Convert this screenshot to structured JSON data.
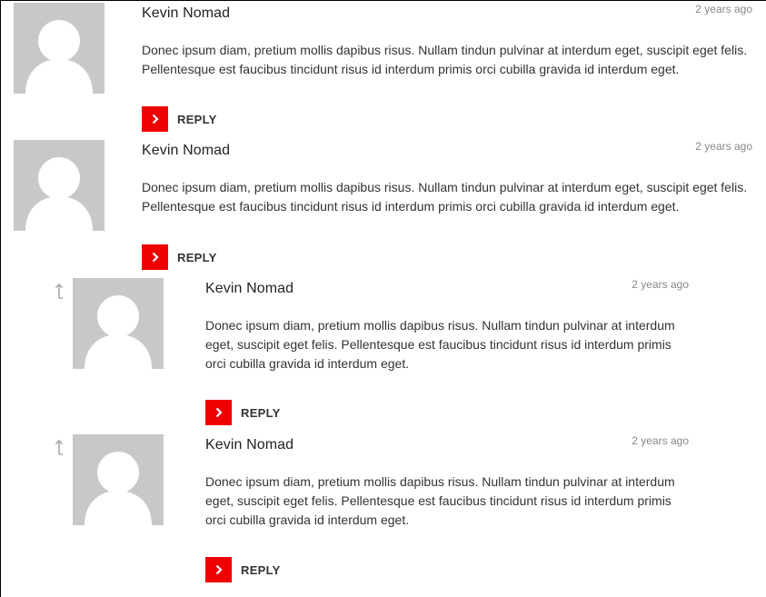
{
  "colors": {
    "accent": "#ee0000",
    "avatar_bg": "#c8c8c8",
    "text": "#333333",
    "meta": "#888888"
  },
  "icons": {
    "avatar": "default-user-silhouette-icon",
    "reply": "chevron-right-icon",
    "child": "up-arrow-child-icon"
  },
  "comments": [
    {
      "author": "Kevin Nomad",
      "date": "2 years ago",
      "text": "Donec ipsum diam, pretium mollis dapibus risus. Nullam tindun pulvinar at interdum eget, suscipit eget felis. Pellentesque est faucibus tincidunt risus id interdum primis orci cubilla gravida id interdum eget.",
      "reply_label": "REPLY"
    },
    {
      "author": "Kevin Nomad",
      "date": "2 years ago",
      "text": "Donec ipsum diam, pretium mollis dapibus risus. Nullam tindun pulvinar at interdum eget, suscipit eget felis. Pellentesque est faucibus tincidunt risus id interdum primis orci cubilla gravida id interdum eget.",
      "reply_label": "REPLY"
    },
    {
      "author": "Kevin Nomad",
      "date": "2 years ago",
      "text": "Donec ipsum diam, pretium mollis dapibus risus. Nullam tindun pulvinar at interdum eget, suscipit eget felis. Pellentesque est faucibus tincidunt risus id interdum primis orci cubilla gravida id interdum eget.",
      "reply_label": "REPLY"
    },
    {
      "author": "Kevin Nomad",
      "date": "2 years ago",
      "text": "Donec ipsum diam, pretium mollis dapibus risus. Nullam tindun pulvinar at interdum eget, suscipit eget felis. Pellentesque est faucibus tincidunt risus id interdum primis orci cubilla gravida id interdum eget.",
      "reply_label": "REPLY"
    }
  ]
}
